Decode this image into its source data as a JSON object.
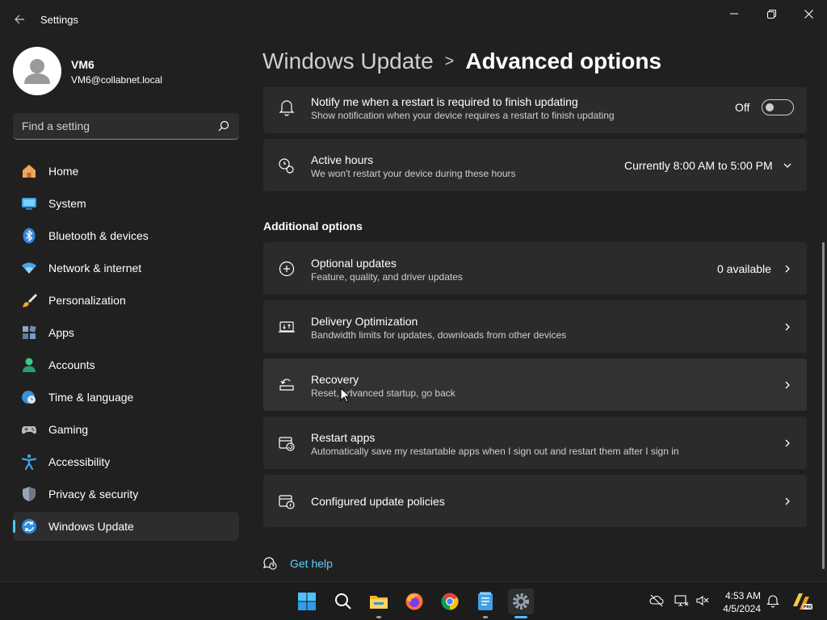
{
  "window": {
    "title": "Settings"
  },
  "profile": {
    "name": "VM6",
    "email": "VM6@collabnet.local"
  },
  "search": {
    "placeholder": "Find a setting"
  },
  "sidebar": {
    "items": [
      {
        "label": "Home",
        "icon": "home-icon"
      },
      {
        "label": "System",
        "icon": "system-icon"
      },
      {
        "label": "Bluetooth & devices",
        "icon": "bluetooth-icon"
      },
      {
        "label": "Network & internet",
        "icon": "network-icon"
      },
      {
        "label": "Personalization",
        "icon": "brush-icon"
      },
      {
        "label": "Apps",
        "icon": "apps-icon"
      },
      {
        "label": "Accounts",
        "icon": "accounts-icon"
      },
      {
        "label": "Time & language",
        "icon": "clock-globe-icon"
      },
      {
        "label": "Gaming",
        "icon": "gamepad-icon"
      },
      {
        "label": "Accessibility",
        "icon": "accessibility-icon"
      },
      {
        "label": "Privacy & security",
        "icon": "shield-icon"
      },
      {
        "label": "Windows Update",
        "icon": "windows-update-icon",
        "active": true
      }
    ]
  },
  "breadcrumb": {
    "parent": "Windows Update",
    "separator": ">",
    "current": "Advanced options"
  },
  "settings": {
    "notify": {
      "title": "Notify me when a restart is required to finish updating",
      "desc": "Show notification when your device requires a restart to finish updating",
      "state_label": "Off",
      "enabled": false
    },
    "active_hours": {
      "title": "Active hours",
      "desc": "We won't restart your device during these hours",
      "value": "Currently 8:00 AM to 5:00 PM"
    }
  },
  "additional": {
    "heading": "Additional options",
    "items": [
      {
        "title": "Optional updates",
        "desc": "Feature, quality, and driver updates",
        "value": "0 available",
        "icon": "plus-circle-icon"
      },
      {
        "title": "Delivery Optimization",
        "desc": "Bandwidth limits for updates, downloads from other devices",
        "value": "",
        "icon": "delivery-optimization-icon"
      },
      {
        "title": "Recovery",
        "desc": "Reset, advanced startup, go back",
        "value": "",
        "icon": "recovery-icon"
      },
      {
        "title": "Restart apps",
        "desc": "Automatically save my restartable apps when I sign out and restart them after I sign in",
        "value": "",
        "icon": "restart-apps-icon"
      },
      {
        "title": "Configured update policies",
        "desc": "",
        "value": "",
        "icon": "policy-icon"
      }
    ]
  },
  "help": {
    "label": "Get help"
  },
  "taskbar": {
    "time": "4:53 AM",
    "date": "4/5/2024",
    "apps": [
      "start-icon",
      "search-icon",
      "file-explorer-icon",
      "firefox-icon",
      "chrome-icon",
      "notepad-icon",
      "settings-icon"
    ]
  },
  "colors": {
    "accent": "#4cc2ff",
    "link": "#60cdff",
    "background": "#202020",
    "card": "#2b2b2b"
  }
}
